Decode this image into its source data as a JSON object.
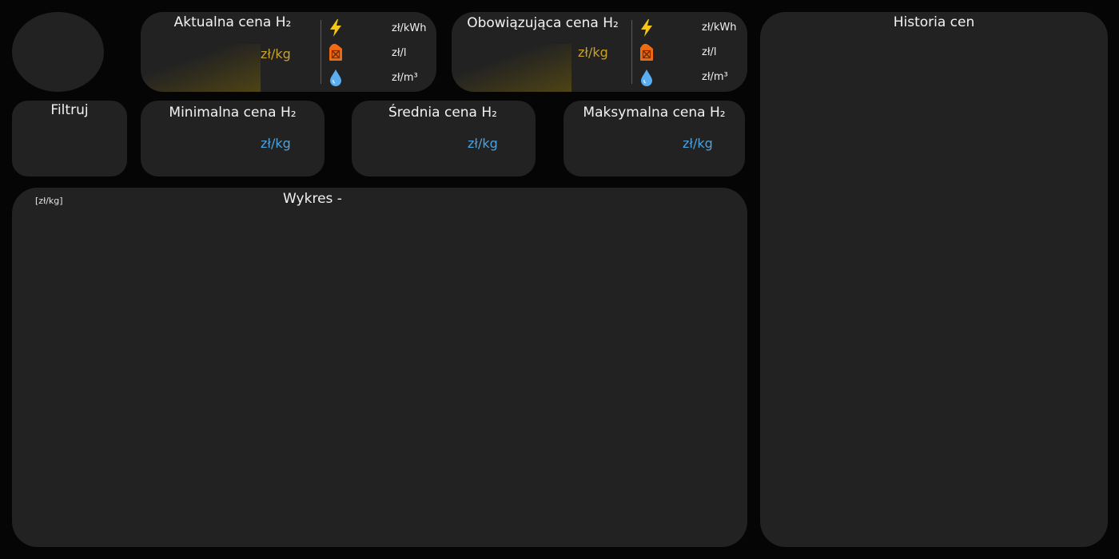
{
  "current_price": {
    "title": "Aktualna cena H₂",
    "unit": "zł/kg",
    "conversions": [
      {
        "icon": "lightning-icon",
        "unit": "zł/kWh"
      },
      {
        "icon": "fuel-canister-icon",
        "unit": "zł/l"
      },
      {
        "icon": "water-drop-icon",
        "unit": "zł/m³"
      }
    ]
  },
  "valid_price": {
    "title": "Obowiązująca cena H₂",
    "unit": "zł/kg",
    "conversions": [
      {
        "icon": "lightning-icon",
        "unit": "zł/kWh"
      },
      {
        "icon": "fuel-canister-icon",
        "unit": "zł/l"
      },
      {
        "icon": "water-drop-icon",
        "unit": "zł/m³"
      }
    ]
  },
  "filter": {
    "title": "Filtruj"
  },
  "min_price": {
    "title": "Minimalna cena H₂",
    "unit": "zł/kg"
  },
  "avg_price": {
    "title": "Średnia cena H₂",
    "unit": "zł/kg"
  },
  "max_price": {
    "title": "Maksymalna cena H₂",
    "unit": "zł/kg"
  },
  "chart": {
    "title": "Wykres -",
    "y_unit": "[zł/kg]"
  },
  "history": {
    "title": "Historia cen"
  },
  "colors": {
    "background": "#050505",
    "panel": "#222222",
    "gold_accent": "#c9a227",
    "blue_accent": "#4aa3df"
  }
}
